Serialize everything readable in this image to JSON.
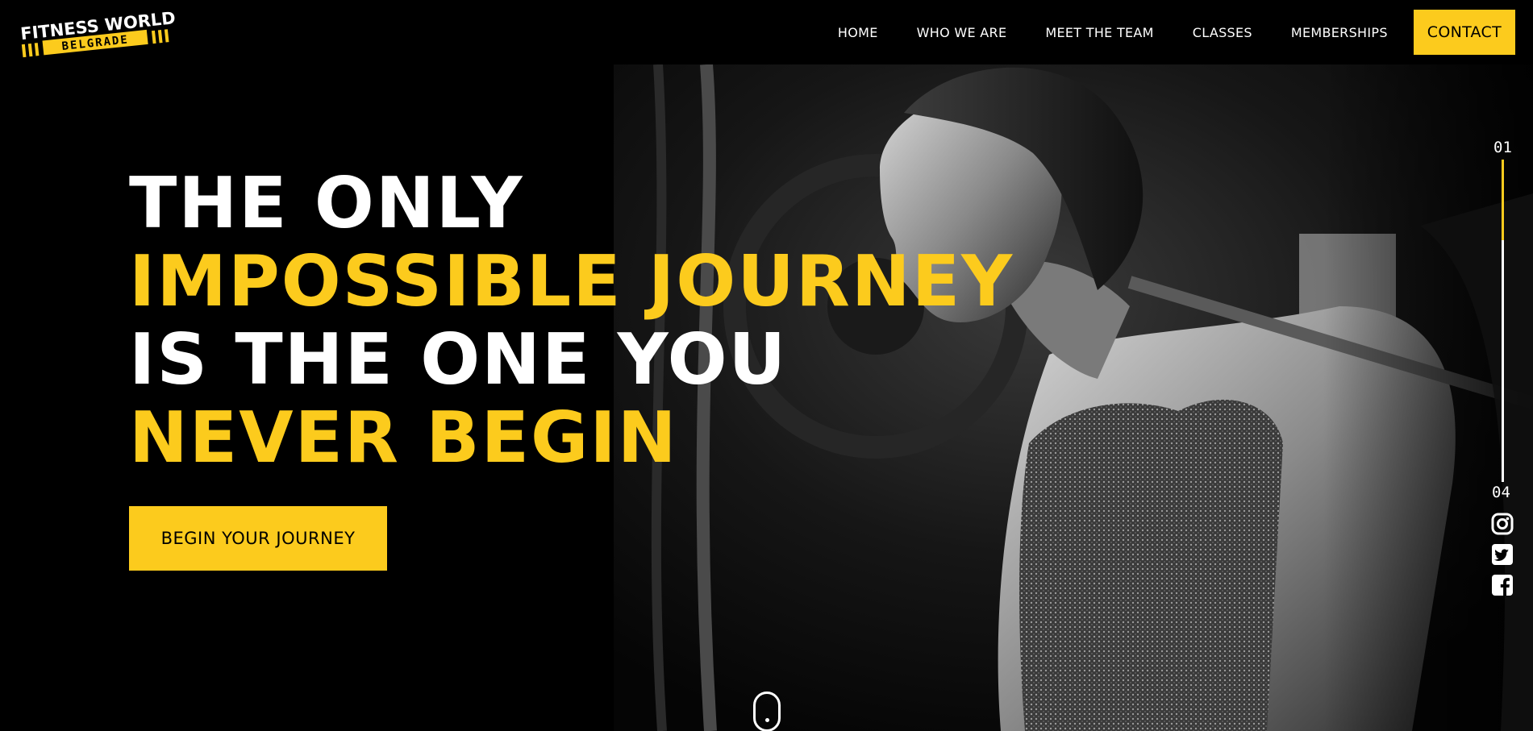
{
  "brand": {
    "line1": "FITNESS WORLD",
    "line2": "BELGRADE",
    "accent_color": "#fccb1d",
    "background_color": "#000000"
  },
  "nav": {
    "items": [
      "HOME",
      "WHO WE ARE",
      "MEET THE TEAM",
      "CLASSES",
      "MEMBERSHIPS"
    ],
    "contact_label": "CONTACT"
  },
  "hero": {
    "lines": [
      {
        "text": "THE ONLY",
        "color": "white"
      },
      {
        "text": "IMPOSSIBLE JOURNEY",
        "color": "yellow"
      },
      {
        "text": "IS THE ONE YOU",
        "color": "white"
      },
      {
        "text": "NEVER BEGIN",
        "color": "yellow"
      }
    ],
    "cta_label": "BEGIN YOUR JOURNEY",
    "photo_icon": "woman-lifting-barbell-photo"
  },
  "slider": {
    "current": "01",
    "total": "04",
    "progress": 0.25
  },
  "social": [
    {
      "name": "instagram-icon"
    },
    {
      "name": "twitter-icon"
    },
    {
      "name": "facebook-icon"
    }
  ],
  "scroll_indicator": {
    "icon": "mouse-scroll-icon"
  }
}
